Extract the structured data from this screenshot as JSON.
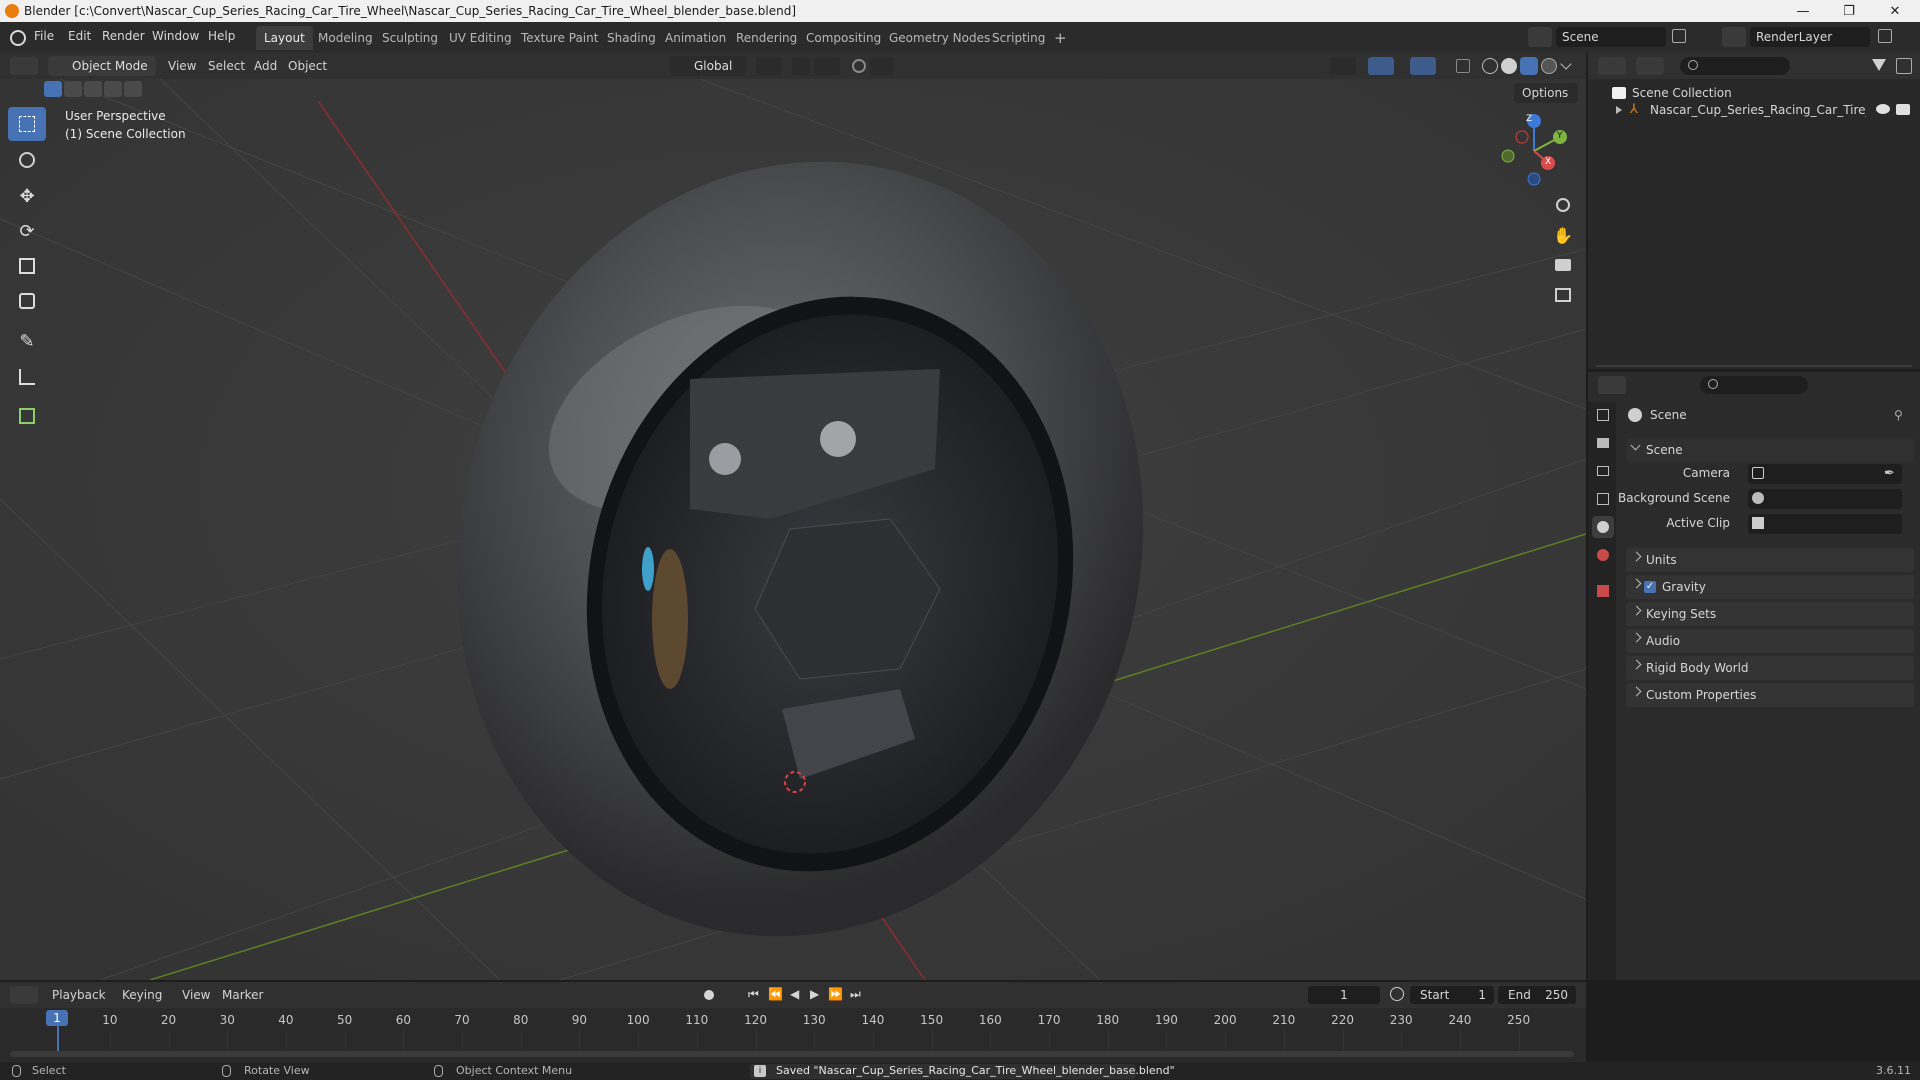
{
  "window": {
    "title": "Blender [c:\\Convert\\Nascar_Cup_Series_Racing_Car_Tire_Wheel\\Nascar_Cup_Series_Racing_Car_Tire_Wheel_blender_base.blend]",
    "minimize": "—",
    "maximize": "❐",
    "close": "✕"
  },
  "menu": {
    "items": [
      "File",
      "Edit",
      "Render",
      "Window",
      "Help"
    ]
  },
  "workspaces": {
    "tabs": [
      "Layout",
      "Modeling",
      "Sculpting",
      "UV Editing",
      "Texture Paint",
      "Shading",
      "Animation",
      "Rendering",
      "Compositing",
      "Geometry Nodes",
      "Scripting"
    ],
    "add": "+"
  },
  "scene_selector": {
    "label": "Scene"
  },
  "layer_selector": {
    "label": "RenderLayer"
  },
  "viewport_header": {
    "mode": "Object Mode",
    "menus": [
      "View",
      "Select",
      "Add",
      "Object"
    ],
    "transform_orientation": "Global",
    "options": "Options"
  },
  "viewport": {
    "perspective_label": "User Perspective",
    "collection_label": "(1) Scene Collection",
    "gizmo": {
      "x": "X",
      "y": "Y",
      "z": "Z"
    }
  },
  "outliner": {
    "root": "Scene Collection",
    "items": [
      {
        "label": "Nascar_Cup_Series_Racing_Car_Tire_Wh"
      }
    ]
  },
  "properties": {
    "header": "Scene",
    "section": "Scene",
    "fields": [
      {
        "label": "Camera"
      },
      {
        "label": "Background Scene"
      },
      {
        "label": "Active Clip"
      }
    ],
    "panels": [
      "Units",
      "Gravity",
      "Keying Sets",
      "Audio",
      "Rigid Body World",
      "Custom Properties"
    ]
  },
  "timeline": {
    "menus": [
      "Playback",
      "Keying",
      "View",
      "Marker"
    ],
    "current_frame": "1",
    "start_label": "Start",
    "start_value": "1",
    "end_label": "End",
    "end_value": "250",
    "ticks": [
      "1",
      "10",
      "20",
      "30",
      "40",
      "50",
      "60",
      "70",
      "80",
      "90",
      "100",
      "110",
      "120",
      "130",
      "140",
      "150",
      "160",
      "170",
      "180",
      "190",
      "200",
      "210",
      "220",
      "230",
      "240",
      "250"
    ],
    "playhead": "1"
  },
  "statusbar": {
    "select": "Select",
    "rotate": "Rotate View",
    "context": "Object Context Menu",
    "message": "Saved \"Nascar_Cup_Series_Racing_Car_Tire_Wheel_blender_base.blend\"",
    "version": "3.6.11"
  }
}
